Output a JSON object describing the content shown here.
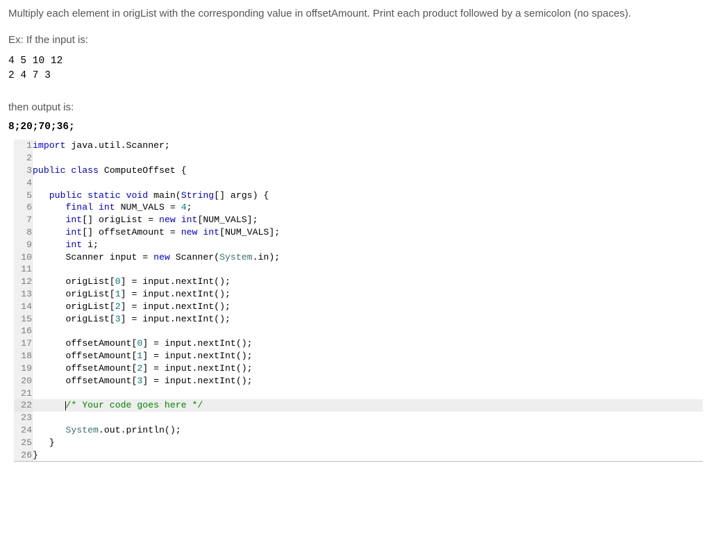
{
  "problem": {
    "statement": "Multiply each element in origList with the corresponding value in offsetAmount. Print each product followed by a semicolon (no spaces).",
    "ex_label": "Ex: If the input is:",
    "input_block": "4 5 10 12\n2 4 7 3",
    "then_label": "then output is:",
    "output_block": "8;20;70;36;"
  },
  "code": {
    "lines": [
      {
        "n": 1,
        "segs": [
          {
            "c": "kw",
            "t": "import"
          },
          {
            "t": " java.util.Scanner;"
          }
        ]
      },
      {
        "n": 2,
        "segs": []
      },
      {
        "n": 3,
        "segs": [
          {
            "c": "kw",
            "t": "public"
          },
          {
            "t": " "
          },
          {
            "c": "kw",
            "t": "class"
          },
          {
            "t": " "
          },
          {
            "c": "cls",
            "t": "ComputeOffset"
          },
          {
            "t": " {"
          }
        ]
      },
      {
        "n": 4,
        "segs": []
      },
      {
        "n": 5,
        "segs": [
          {
            "t": "   "
          },
          {
            "c": "kw",
            "t": "public"
          },
          {
            "t": " "
          },
          {
            "c": "kw",
            "t": "static"
          },
          {
            "t": " "
          },
          {
            "c": "kw",
            "t": "void"
          },
          {
            "t": " main("
          },
          {
            "c": "typ",
            "t": "String"
          },
          {
            "t": "[] args) {"
          }
        ]
      },
      {
        "n": 6,
        "segs": [
          {
            "t": "      "
          },
          {
            "c": "kw",
            "t": "final"
          },
          {
            "t": " "
          },
          {
            "c": "kw",
            "t": "int"
          },
          {
            "t": " NUM_VALS = "
          },
          {
            "c": "num",
            "t": "4"
          },
          {
            "t": ";"
          }
        ]
      },
      {
        "n": 7,
        "segs": [
          {
            "t": "      "
          },
          {
            "c": "kw",
            "t": "int"
          },
          {
            "t": "[] origList = "
          },
          {
            "c": "kw",
            "t": "new"
          },
          {
            "t": " "
          },
          {
            "c": "kw",
            "t": "int"
          },
          {
            "t": "[NUM_VALS];"
          }
        ]
      },
      {
        "n": 8,
        "segs": [
          {
            "t": "      "
          },
          {
            "c": "kw",
            "t": "int"
          },
          {
            "t": "[] offsetAmount = "
          },
          {
            "c": "kw",
            "t": "new"
          },
          {
            "t": " "
          },
          {
            "c": "kw",
            "t": "int"
          },
          {
            "t": "[NUM_VALS];"
          }
        ]
      },
      {
        "n": 9,
        "segs": [
          {
            "t": "      "
          },
          {
            "c": "kw",
            "t": "int"
          },
          {
            "t": " i;"
          }
        ]
      },
      {
        "n": 10,
        "segs": [
          {
            "t": "      Scanner input = "
          },
          {
            "c": "kw",
            "t": "new"
          },
          {
            "t": " Scanner("
          },
          {
            "c": "sys",
            "t": "System"
          },
          {
            "t": ".in);"
          }
        ]
      },
      {
        "n": 11,
        "segs": []
      },
      {
        "n": 12,
        "segs": [
          {
            "t": "      origList["
          },
          {
            "c": "num",
            "t": "0"
          },
          {
            "t": "] = input.nextInt();"
          }
        ]
      },
      {
        "n": 13,
        "segs": [
          {
            "t": "      origList["
          },
          {
            "c": "num",
            "t": "1"
          },
          {
            "t": "] = input.nextInt();"
          }
        ]
      },
      {
        "n": 14,
        "segs": [
          {
            "t": "      origList["
          },
          {
            "c": "num",
            "t": "2"
          },
          {
            "t": "] = input.nextInt();"
          }
        ]
      },
      {
        "n": 15,
        "segs": [
          {
            "t": "      origList["
          },
          {
            "c": "num",
            "t": "3"
          },
          {
            "t": "] = input.nextInt();"
          }
        ]
      },
      {
        "n": 16,
        "segs": []
      },
      {
        "n": 17,
        "segs": [
          {
            "t": "      offsetAmount["
          },
          {
            "c": "num",
            "t": "0"
          },
          {
            "t": "] = input.nextInt();"
          }
        ]
      },
      {
        "n": 18,
        "segs": [
          {
            "t": "      offsetAmount["
          },
          {
            "c": "num",
            "t": "1"
          },
          {
            "t": "] = input.nextInt();"
          }
        ]
      },
      {
        "n": 19,
        "segs": [
          {
            "t": "      offsetAmount["
          },
          {
            "c": "num",
            "t": "2"
          },
          {
            "t": "] = input.nextInt();"
          }
        ]
      },
      {
        "n": 20,
        "segs": [
          {
            "t": "      offsetAmount["
          },
          {
            "c": "num",
            "t": "3"
          },
          {
            "t": "] = input.nextInt();"
          }
        ]
      },
      {
        "n": 21,
        "segs": []
      },
      {
        "n": 22,
        "active": true,
        "cursor": true,
        "segs": [
          {
            "t": "      "
          },
          {
            "c": "cmt",
            "t": "/* Your code goes here */"
          }
        ]
      },
      {
        "n": 23,
        "segs": []
      },
      {
        "n": 24,
        "segs": [
          {
            "t": "      "
          },
          {
            "c": "sys",
            "t": "System"
          },
          {
            "t": ".out.println();"
          }
        ]
      },
      {
        "n": 25,
        "segs": [
          {
            "t": "   }"
          }
        ]
      },
      {
        "n": 26,
        "segs": [
          {
            "t": "}"
          }
        ]
      }
    ]
  }
}
